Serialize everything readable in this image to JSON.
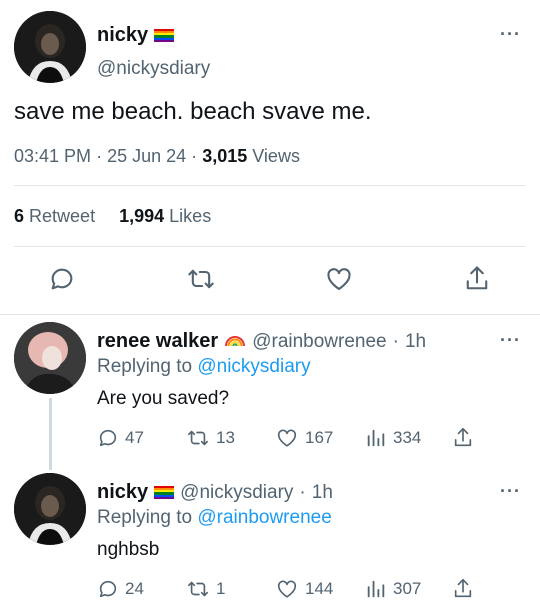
{
  "main_tweet": {
    "name": "nicky",
    "handle": "@nickysdiary",
    "text": "save me beach. beach svave me.",
    "time": "03:41 PM",
    "date": "25 Jun 24",
    "views_count": "3,015",
    "views_label": "Views",
    "retweets_count": "6",
    "retweets_label": "Retweet",
    "likes_count": "1,994",
    "likes_label": "Likes"
  },
  "reply1": {
    "name": "renee walker",
    "handle": "@rainbowrenee",
    "time": "1h",
    "replying_label": "Replying to",
    "replying_to": "@nickysdiary",
    "text": "Are you saved?",
    "replies": "47",
    "retweets": "13",
    "likes": "167",
    "views": "334"
  },
  "reply2": {
    "name": "nicky",
    "handle": "@nickysdiary",
    "time": "1h",
    "replying_label": "Replying to",
    "replying_to": "@rainbowrenee",
    "text": "nghbsb",
    "replies": "24",
    "retweets": "1",
    "likes": "144",
    "views": "307"
  },
  "separators": {
    "dot": "·"
  },
  "colors": {
    "accent": "#1d9bf0",
    "secondary_text": "#536471",
    "divider": "#e1e6ea"
  },
  "icons": [
    "more-icon",
    "reply-icon",
    "retweet-icon",
    "like-icon",
    "share-icon",
    "views-icon",
    "pride-flag-icon",
    "rainbow-icon"
  ]
}
